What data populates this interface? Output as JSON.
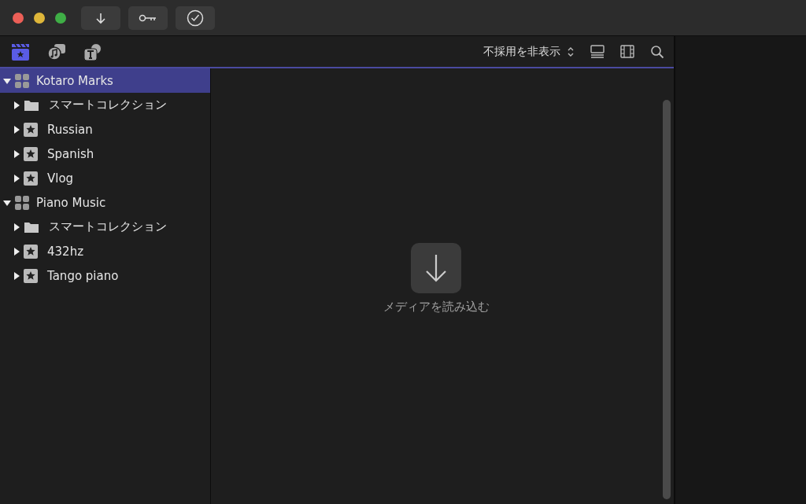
{
  "browser_tabs": [
    {
      "kind": "media",
      "selected": true
    },
    {
      "kind": "audio",
      "selected": false
    },
    {
      "kind": "titles",
      "selected": false
    }
  ],
  "filter": {
    "label": "不採用を非表示"
  },
  "libraries": [
    {
      "name": "Kotaro Marks",
      "expanded": true,
      "selected": true,
      "children": [
        {
          "kind": "folder",
          "name": "スマートコレクション",
          "expanded": false,
          "selected": false
        },
        {
          "kind": "event",
          "name": "Russian",
          "expanded": false,
          "selected": false
        },
        {
          "kind": "event",
          "name": "Spanish",
          "expanded": false,
          "selected": false
        },
        {
          "kind": "event",
          "name": "Vlog",
          "expanded": false,
          "selected": false
        }
      ]
    },
    {
      "name": "Piano Music",
      "expanded": true,
      "selected": false,
      "children": [
        {
          "kind": "folder",
          "name": "スマートコレクション",
          "expanded": false,
          "selected": false
        },
        {
          "kind": "event",
          "name": "432hz",
          "expanded": false,
          "selected": false
        },
        {
          "kind": "event",
          "name": "Tango piano",
          "expanded": false,
          "selected": false
        }
      ]
    }
  ],
  "import": {
    "label": "メディアを読み込む"
  }
}
